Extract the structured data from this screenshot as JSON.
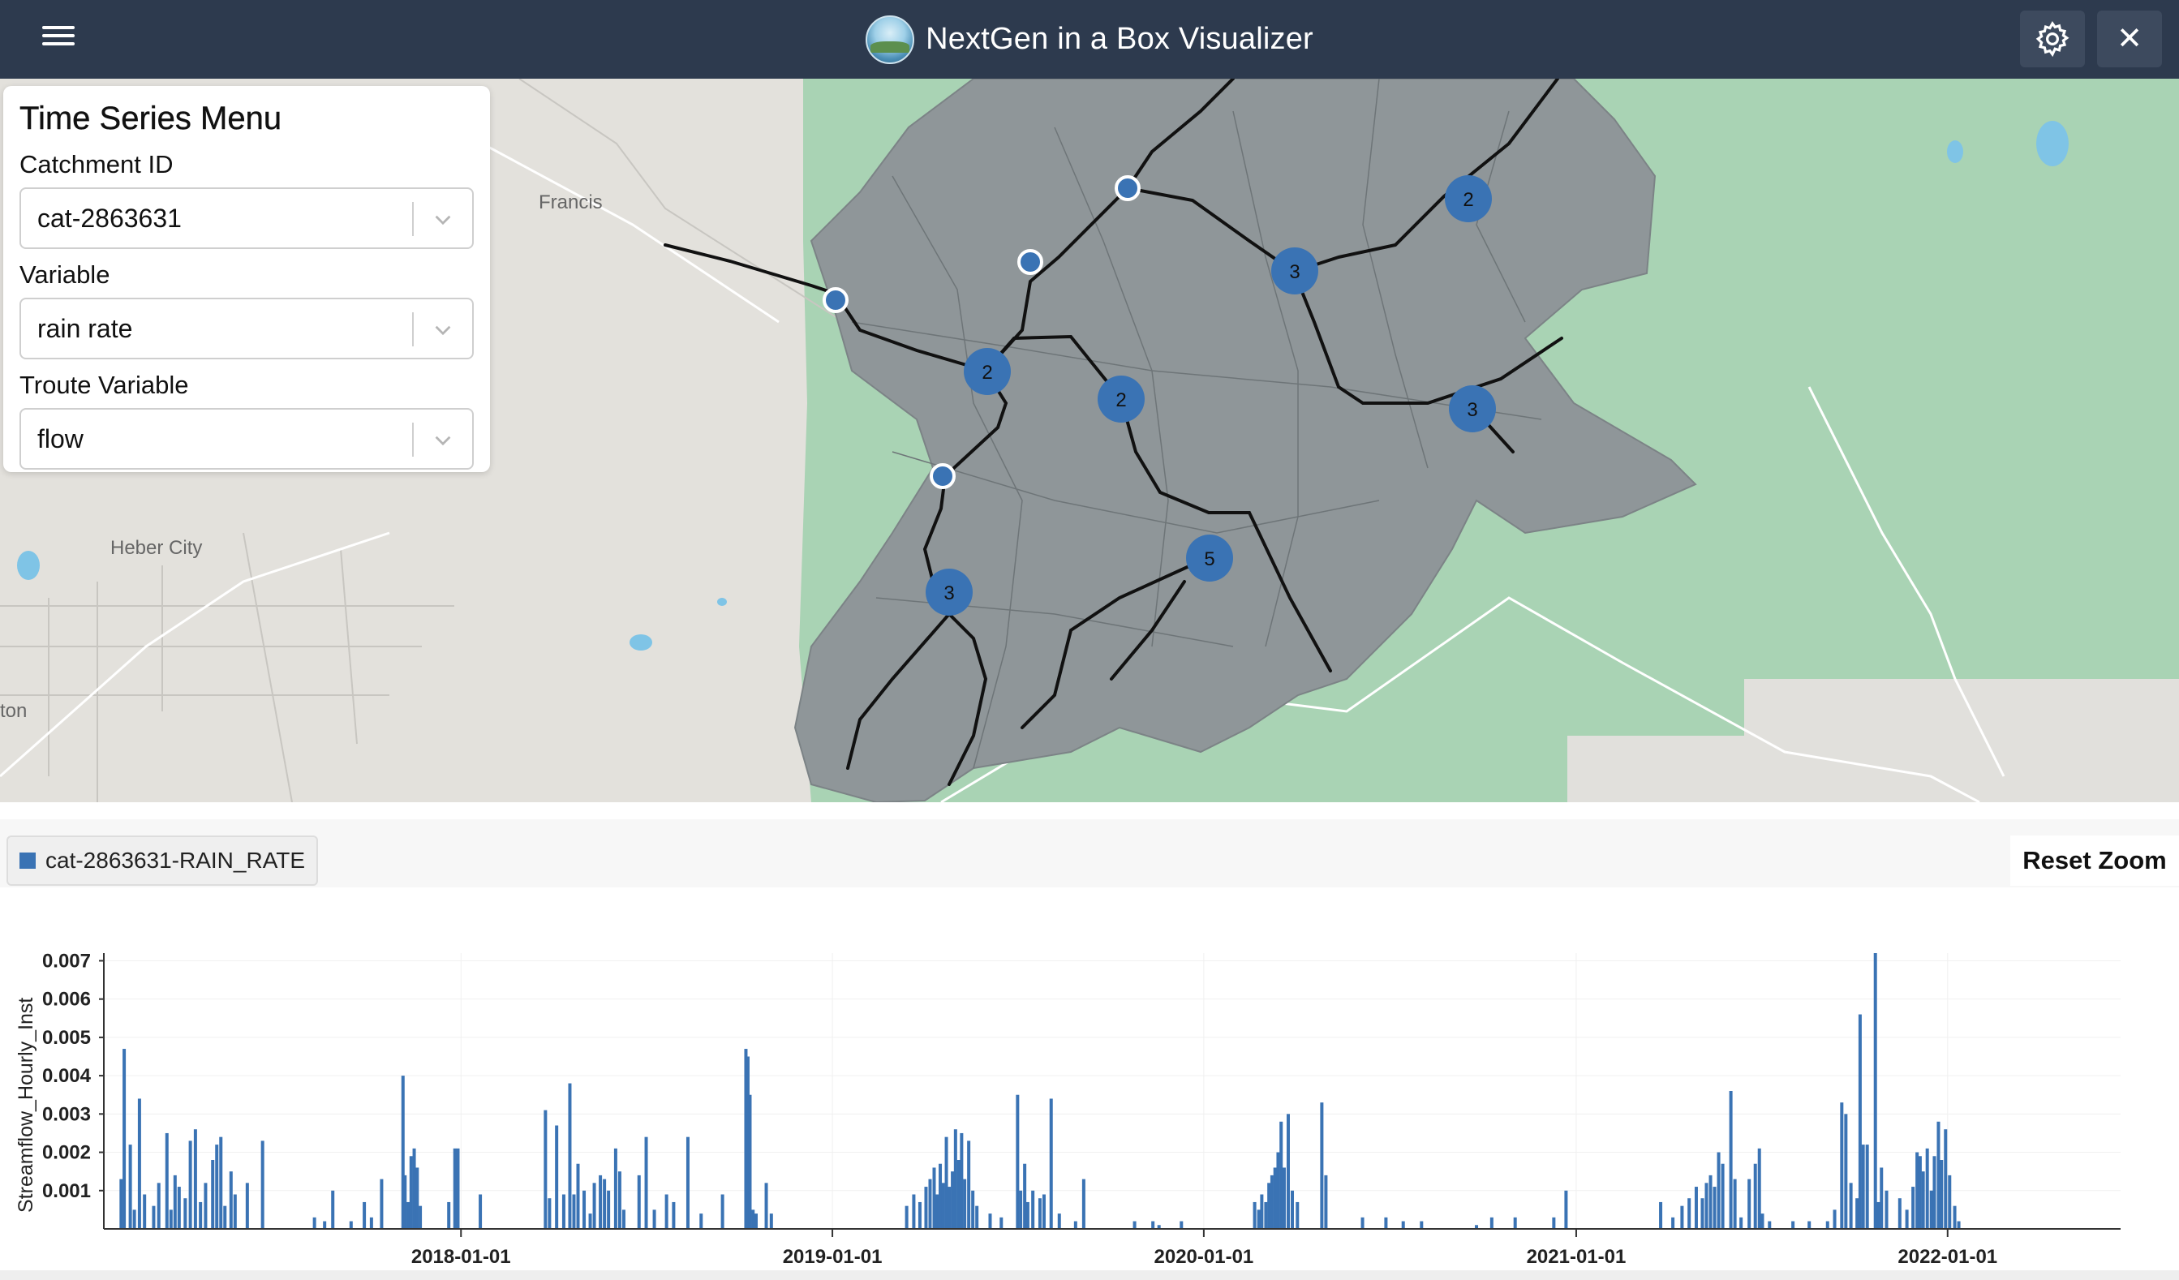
{
  "header": {
    "title": "NextGen in a Box Visualizer",
    "menu_icon": "hamburger-menu-icon",
    "settings_icon": "gear-icon",
    "close_icon": "close-icon",
    "close_glyph": "✕",
    "background_color": "#2d3a4e"
  },
  "map": {
    "place_labels": [
      "Francis",
      "Heber City",
      "ton"
    ],
    "cluster_markers": [
      "2",
      "3",
      "2",
      "2",
      "3",
      "5",
      "3"
    ],
    "colors": {
      "catchment": "#8f9699",
      "forest": "#a9d3b4",
      "marker": "#3a73b4"
    }
  },
  "time_series_menu": {
    "title": "Time Series Menu",
    "fields": [
      {
        "label": "Catchment ID",
        "value": "cat-2863631"
      },
      {
        "label": "Variable",
        "value": "rain rate"
      },
      {
        "label": "Troute Variable",
        "value": "flow"
      }
    ]
  },
  "chart_toolbar": {
    "legend_label": "cat-2863631-RAIN_RATE",
    "reset_zoom_label": "Reset Zoom"
  },
  "chart_data": {
    "type": "bar",
    "title": "",
    "xlabel": "",
    "ylabel": "Streamflow_Hourly_Inst",
    "x_ticks": [
      "2018-01-01",
      "2019-01-01",
      "2020-01-01",
      "2021-01-01",
      "2022-01-01"
    ],
    "y_ticks": [
      "0.001",
      "0.002",
      "0.003",
      "0.004",
      "0.005",
      "0.006",
      "0.007"
    ],
    "xlim": [
      "2017-01-15",
      "2022-06-20"
    ],
    "ylim": [
      0,
      0.0072
    ],
    "series": [
      {
        "color": "#3a73b4",
        "points": [
          [
            "2017-02-01",
            0.0013
          ],
          [
            "2017-02-04",
            0.0047
          ],
          [
            "2017-02-10",
            0.0022
          ],
          [
            "2017-02-14",
            0.0005
          ],
          [
            "2017-02-19",
            0.0034
          ],
          [
            "2017-02-24",
            0.0009
          ],
          [
            "2017-03-05",
            0.0006
          ],
          [
            "2017-03-10",
            0.0012
          ],
          [
            "2017-03-18",
            0.0025
          ],
          [
            "2017-03-22",
            0.0005
          ],
          [
            "2017-03-26",
            0.0014
          ],
          [
            "2017-03-30",
            0.0011
          ],
          [
            "2017-04-05",
            0.0008
          ],
          [
            "2017-04-10",
            0.0023
          ],
          [
            "2017-04-15",
            0.0026
          ],
          [
            "2017-04-20",
            0.0007
          ],
          [
            "2017-04-25",
            0.0012
          ],
          [
            "2017-05-02",
            0.0018
          ],
          [
            "2017-05-06",
            0.0022
          ],
          [
            "2017-05-10",
            0.0024
          ],
          [
            "2017-05-14",
            0.0006
          ],
          [
            "2017-05-20",
            0.0015
          ],
          [
            "2017-05-24",
            0.0009
          ],
          [
            "2017-06-05",
            0.0012
          ],
          [
            "2017-06-20",
            0.0023
          ],
          [
            "2017-08-10",
            0.0003
          ],
          [
            "2017-08-20",
            0.0002
          ],
          [
            "2017-08-28",
            0.001
          ],
          [
            "2017-09-15",
            0.0002
          ],
          [
            "2017-09-28",
            0.0007
          ],
          [
            "2017-10-05",
            0.0003
          ],
          [
            "2017-10-15",
            0.0013
          ],
          [
            "2017-11-05",
            0.004
          ],
          [
            "2017-11-07",
            0.0014
          ],
          [
            "2017-11-10",
            0.0007
          ],
          [
            "2017-11-13",
            0.0019
          ],
          [
            "2017-11-16",
            0.0021
          ],
          [
            "2017-11-19",
            0.0016
          ],
          [
            "2017-11-22",
            0.0006
          ],
          [
            "2017-12-20",
            0.0007
          ],
          [
            "2017-12-26",
            0.0021
          ],
          [
            "2017-12-29",
            0.0021
          ],
          [
            "2018-01-20",
            0.0009
          ],
          [
            "2018-03-25",
            0.0031
          ],
          [
            "2018-03-29",
            0.0008
          ],
          [
            "2018-04-05",
            0.0027
          ],
          [
            "2018-04-12",
            0.0009
          ],
          [
            "2018-04-18",
            0.0038
          ],
          [
            "2018-04-22",
            0.0009
          ],
          [
            "2018-04-26",
            0.0017
          ],
          [
            "2018-05-02",
            0.001
          ],
          [
            "2018-05-08",
            0.0004
          ],
          [
            "2018-05-12",
            0.0012
          ],
          [
            "2018-05-18",
            0.0014
          ],
          [
            "2018-05-22",
            0.0013
          ],
          [
            "2018-05-26",
            0.001
          ],
          [
            "2018-06-02",
            0.0021
          ],
          [
            "2018-06-06",
            0.0015
          ],
          [
            "2018-06-10",
            0.0005
          ],
          [
            "2018-06-25",
            0.0014
          ],
          [
            "2018-07-02",
            0.0024
          ],
          [
            "2018-07-10",
            0.0005
          ],
          [
            "2018-07-22",
            0.0009
          ],
          [
            "2018-07-29",
            0.0007
          ],
          [
            "2018-08-12",
            0.0024
          ],
          [
            "2018-08-25",
            0.0004
          ],
          [
            "2018-09-15",
            0.0009
          ],
          [
            "2018-10-08",
            0.0047
          ],
          [
            "2018-10-10",
            0.0045
          ],
          [
            "2018-10-12",
            0.0035
          ],
          [
            "2018-10-15",
            0.0005
          ],
          [
            "2018-10-18",
            0.0004
          ],
          [
            "2018-10-28",
            0.0012
          ],
          [
            "2018-11-02",
            0.0004
          ],
          [
            "2019-03-15",
            0.0006
          ],
          [
            "2019-03-22",
            0.0009
          ],
          [
            "2019-03-28",
            0.0007
          ],
          [
            "2019-04-03",
            0.0011
          ],
          [
            "2019-04-07",
            0.0013
          ],
          [
            "2019-04-11",
            0.0016
          ],
          [
            "2019-04-14",
            0.0009
          ],
          [
            "2019-04-17",
            0.0017
          ],
          [
            "2019-04-20",
            0.0012
          ],
          [
            "2019-04-23",
            0.0024
          ],
          [
            "2019-04-26",
            0.0011
          ],
          [
            "2019-04-29",
            0.0015
          ],
          [
            "2019-05-02",
            0.0026
          ],
          [
            "2019-05-05",
            0.0018
          ],
          [
            "2019-05-08",
            0.0025
          ],
          [
            "2019-05-11",
            0.0013
          ],
          [
            "2019-05-15",
            0.0023
          ],
          [
            "2019-05-19",
            0.001
          ],
          [
            "2019-05-23",
            0.0006
          ],
          [
            "2019-06-05",
            0.0004
          ],
          [
            "2019-06-16",
            0.0003
          ],
          [
            "2019-07-02",
            0.0035
          ],
          [
            "2019-07-05",
            0.001
          ],
          [
            "2019-07-09",
            0.0017
          ],
          [
            "2019-07-12",
            0.0007
          ],
          [
            "2019-07-17",
            0.001
          ],
          [
            "2019-07-24",
            0.0008
          ],
          [
            "2019-07-28",
            0.0009
          ],
          [
            "2019-08-04",
            0.0034
          ],
          [
            "2019-08-12",
            0.0004
          ],
          [
            "2019-08-28",
            0.0002
          ],
          [
            "2019-09-05",
            0.0013
          ],
          [
            "2019-10-25",
            0.0002
          ],
          [
            "2019-11-12",
            0.0002
          ],
          [
            "2019-11-18",
            0.0001
          ],
          [
            "2019-12-10",
            0.0002
          ],
          [
            "2020-02-20",
            0.0007
          ],
          [
            "2020-02-24",
            0.0005
          ],
          [
            "2020-02-27",
            0.0009
          ],
          [
            "2020-03-02",
            0.0007
          ],
          [
            "2020-03-05",
            0.0012
          ],
          [
            "2020-03-08",
            0.0014
          ],
          [
            "2020-03-11",
            0.0016
          ],
          [
            "2020-03-14",
            0.002
          ],
          [
            "2020-03-17",
            0.0028
          ],
          [
            "2020-03-20",
            0.0016
          ],
          [
            "2020-03-24",
            0.003
          ],
          [
            "2020-03-28",
            0.001
          ],
          [
            "2020-04-02",
            0.0007
          ],
          [
            "2020-04-26",
            0.0033
          ],
          [
            "2020-04-30",
            0.0014
          ],
          [
            "2020-06-05",
            0.0003
          ],
          [
            "2020-06-28",
            0.0003
          ],
          [
            "2020-07-15",
            0.0002
          ],
          [
            "2020-08-02",
            0.0002
          ],
          [
            "2020-09-25",
            0.0001
          ],
          [
            "2020-10-10",
            0.0003
          ],
          [
            "2020-11-02",
            0.0003
          ],
          [
            "2020-12-10",
            0.0003
          ],
          [
            "2020-12-22",
            0.001
          ],
          [
            "2021-03-25",
            0.0007
          ],
          [
            "2021-04-06",
            0.0003
          ],
          [
            "2021-04-15",
            0.0006
          ],
          [
            "2021-04-22",
            0.0008
          ],
          [
            "2021-04-29",
            0.0011
          ],
          [
            "2021-05-05",
            0.0008
          ],
          [
            "2021-05-09",
            0.0012
          ],
          [
            "2021-05-13",
            0.0014
          ],
          [
            "2021-05-17",
            0.0011
          ],
          [
            "2021-05-21",
            0.002
          ],
          [
            "2021-05-25",
            0.0017
          ],
          [
            "2021-06-02",
            0.0036
          ],
          [
            "2021-06-06",
            0.0013
          ],
          [
            "2021-06-12",
            0.0003
          ],
          [
            "2021-06-20",
            0.0013
          ],
          [
            "2021-06-26",
            0.0017
          ],
          [
            "2021-06-30",
            0.0021
          ],
          [
            "2021-07-03",
            0.0004
          ],
          [
            "2021-07-10",
            0.0002
          ],
          [
            "2021-08-02",
            0.0002
          ],
          [
            "2021-08-18",
            0.0002
          ],
          [
            "2021-09-05",
            0.0002
          ],
          [
            "2021-09-12",
            0.0005
          ],
          [
            "2021-09-19",
            0.0033
          ],
          [
            "2021-09-23",
            0.003
          ],
          [
            "2021-09-28",
            0.0012
          ],
          [
            "2021-10-04",
            0.0008
          ],
          [
            "2021-10-07",
            0.0056
          ],
          [
            "2021-10-10",
            0.0022
          ],
          [
            "2021-10-14",
            0.0022
          ],
          [
            "2021-10-22",
            0.0072
          ],
          [
            "2021-10-25",
            0.0007
          ],
          [
            "2021-10-28",
            0.0016
          ],
          [
            "2021-11-02",
            0.001
          ],
          [
            "2021-11-15",
            0.0008
          ],
          [
            "2021-11-22",
            0.0005
          ],
          [
            "2021-11-28",
            0.0011
          ],
          [
            "2021-12-02",
            0.002
          ],
          [
            "2021-12-05",
            0.0019
          ],
          [
            "2021-12-08",
            0.0015
          ],
          [
            "2021-12-12",
            0.0021
          ],
          [
            "2021-12-16",
            0.001
          ],
          [
            "2021-12-19",
            0.0019
          ],
          [
            "2021-12-23",
            0.0028
          ],
          [
            "2021-12-26",
            0.0018
          ],
          [
            "2021-12-30",
            0.0026
          ],
          [
            "2022-01-03",
            0.0014
          ],
          [
            "2022-01-08",
            0.0006
          ],
          [
            "2022-01-12",
            0.0002
          ]
        ]
      }
    ]
  }
}
